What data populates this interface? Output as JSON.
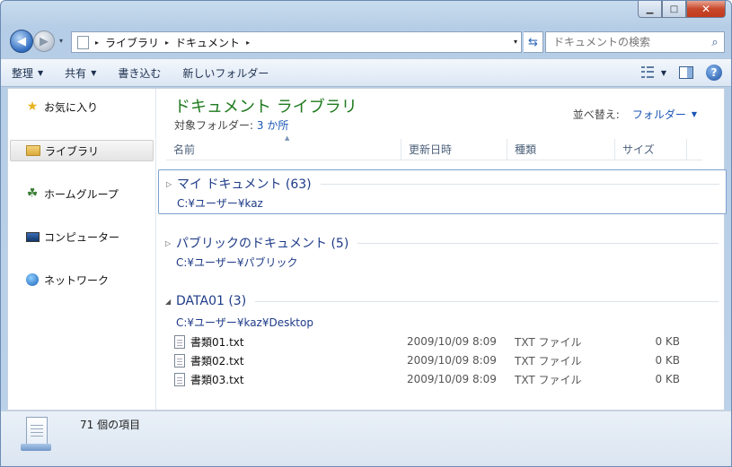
{
  "window": {
    "minimize_glyph": "▁",
    "maximize_glyph": "□",
    "close_glyph": "✕"
  },
  "navigation": {
    "back_glyph": "◀",
    "forward_glyph": "▶",
    "history_glyph": "▾",
    "breadcrumb": [
      "ライブラリ",
      "ドキュメント"
    ],
    "breadcrumb_sep": "▸",
    "address_dropdown_glyph": "▾",
    "refresh_glyph": "⇆",
    "search_placeholder": "ドキュメントの検索",
    "search_icon": "search-icon"
  },
  "toolbar": {
    "organize": "整理",
    "share": "共有",
    "burn": "書き込む",
    "new_folder": "新しいフォルダー",
    "dropdown_glyph": "▼",
    "help_glyph": "?"
  },
  "sidebar": {
    "items": [
      {
        "label": "お気に入り",
        "icon": "star-icon"
      },
      {
        "label": "ライブラリ",
        "icon": "library-icon",
        "selected": true
      },
      {
        "label": "ホームグループ",
        "icon": "homegroup-icon"
      },
      {
        "label": "コンピューター",
        "icon": "computer-icon"
      },
      {
        "label": "ネットワーク",
        "icon": "network-icon"
      }
    ],
    "star_glyph": "★",
    "home_glyph": "☘"
  },
  "library": {
    "title": "ドキュメント ライブラリ",
    "subtitle_prefix": "対象フォルダー:",
    "subtitle_link": "3 か所",
    "arrange_label": "並べ替え:",
    "arrange_value": "フォルダー",
    "arrange_glyph": "▼"
  },
  "columns": {
    "name": "名前",
    "date": "更新日時",
    "type": "種類",
    "size": "サイズ",
    "sort_glyph": "▲"
  },
  "groups": [
    {
      "name": "マイ ドキュメント (63)",
      "path": "C:¥ユーザー¥kaz",
      "collapsed_glyph": "▷"
    },
    {
      "name": "パブリックのドキュメント (5)",
      "path": "C:¥ユーザー¥パブリック",
      "collapsed_glyph": "▷"
    },
    {
      "name": "DATA01 (3)",
      "path": "C:¥ユーザー¥kaz¥Desktop",
      "expanded_glyph": "◢"
    }
  ],
  "files": [
    {
      "name": "書類01.txt",
      "date": "2009/10/09 8:09",
      "type": "TXT ファイル",
      "size": "0 KB"
    },
    {
      "name": "書類02.txt",
      "date": "2009/10/09 8:09",
      "type": "TXT ファイル",
      "size": "0 KB"
    },
    {
      "name": "書類03.txt",
      "date": "2009/10/09 8:09",
      "type": "TXT ファイル",
      "size": "0 KB"
    }
  ],
  "status": {
    "item_count": "71 個の項目"
  }
}
